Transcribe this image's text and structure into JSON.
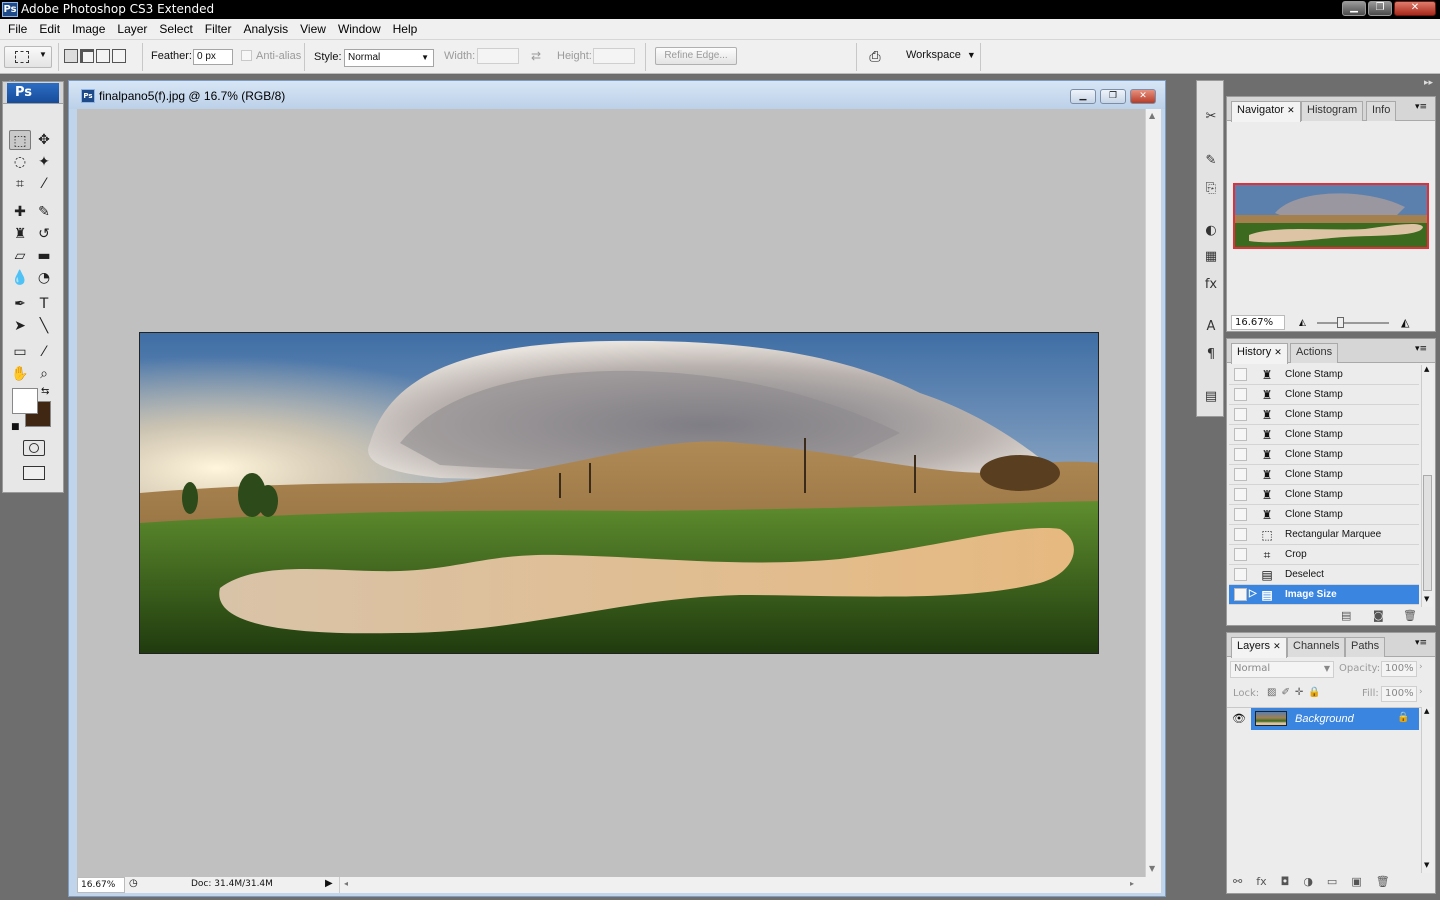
{
  "app": {
    "title": "Adobe Photoshop CS3 Extended",
    "badge": "Ps",
    "window_buttons": [
      "▁",
      "❐",
      "✕"
    ]
  },
  "menu": [
    "File",
    "Edit",
    "Image",
    "Layer",
    "Select",
    "Filter",
    "Analysis",
    "View",
    "Window",
    "Help"
  ],
  "options": {
    "feather_label": "Feather:",
    "feather_value": "0 px",
    "antialias_label": "Anti-alias",
    "style_label": "Style:",
    "style_value": "Normal",
    "width_label": "Width:",
    "height_label": "Height:",
    "refine_edge": "Refine Edge...",
    "workspace": "Workspace"
  },
  "toolbox": {
    "logo": "Ps",
    "tools": [
      "marquee-icon",
      "move-icon",
      "lasso-icon",
      "magic-wand-icon",
      "crop-icon",
      "eyedropper-icon",
      "healing-brush-icon",
      "brush-icon",
      "clone-stamp-icon",
      "history-brush-icon",
      "eraser-icon",
      "gradient-icon",
      "blur-icon",
      "dodge-icon",
      "pen-icon",
      "type-icon",
      "path-selection-icon",
      "line-icon",
      "notes-icon",
      "eyedropper2-icon",
      "hand-icon",
      "zoom-icon"
    ],
    "foreground_color": "#ffffff",
    "background_color": "#3f2713"
  },
  "document": {
    "title": "finalpano5(f).jpg @ 16.7% (RGB/8)",
    "zoom": "16.67%",
    "doc_size": "Doc: 31.4M/31.4M"
  },
  "navigator": {
    "tabs": [
      "Navigator",
      "Histogram",
      "Info"
    ],
    "zoom": "16.67%",
    "zoom_slider_fraction": 0.28
  },
  "history": {
    "tabs": [
      "History",
      "Actions"
    ],
    "items": [
      {
        "label": "Clone Stamp",
        "icon": "clone-stamp-icon"
      },
      {
        "label": "Clone Stamp",
        "icon": "clone-stamp-icon"
      },
      {
        "label": "Clone Stamp",
        "icon": "clone-stamp-icon"
      },
      {
        "label": "Clone Stamp",
        "icon": "clone-stamp-icon"
      },
      {
        "label": "Clone Stamp",
        "icon": "clone-stamp-icon"
      },
      {
        "label": "Clone Stamp",
        "icon": "clone-stamp-icon"
      },
      {
        "label": "Clone Stamp",
        "icon": "clone-stamp-icon"
      },
      {
        "label": "Clone Stamp",
        "icon": "clone-stamp-icon"
      },
      {
        "label": "Rectangular Marquee",
        "icon": "marquee-icon"
      },
      {
        "label": "Crop",
        "icon": "crop-icon"
      },
      {
        "label": "Deselect",
        "icon": "document-icon"
      },
      {
        "label": "Image Size",
        "icon": "document-icon",
        "selected": true
      }
    ]
  },
  "layers": {
    "tabs": [
      "Layers",
      "Channels",
      "Paths"
    ],
    "blend_mode": "Normal",
    "opacity_label": "Opacity:",
    "opacity": "100%",
    "lock_label": "Lock:",
    "fill_label": "Fill:",
    "fill": "100%",
    "layer_name": "Background"
  },
  "colors": {
    "accent": "#3a85e0",
    "doc_frame": "#c0d5ec"
  }
}
